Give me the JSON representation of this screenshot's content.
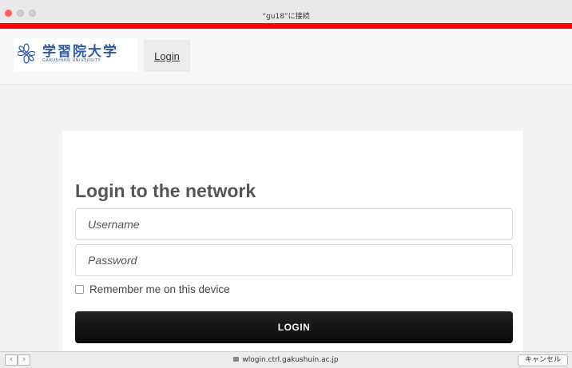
{
  "window": {
    "title": "“gu18”に接続"
  },
  "header": {
    "logo": {
      "jp": "学習院大学",
      "en": "GAKUSHUIN UNIVERSITY"
    },
    "nav_login": "Login"
  },
  "form": {
    "title": "Login to the network",
    "username_placeholder": "Username",
    "password_placeholder": "Password",
    "remember_label": "Remember me on this device",
    "remember_checked": false,
    "login_button": "LOGIN"
  },
  "bottom": {
    "url": "wlogin.ctrl.gakushuin.ac.jp",
    "cancel": "キャンセル"
  },
  "colors": {
    "alert_bar": "#ff0000",
    "brand": "#2d5aa8"
  }
}
